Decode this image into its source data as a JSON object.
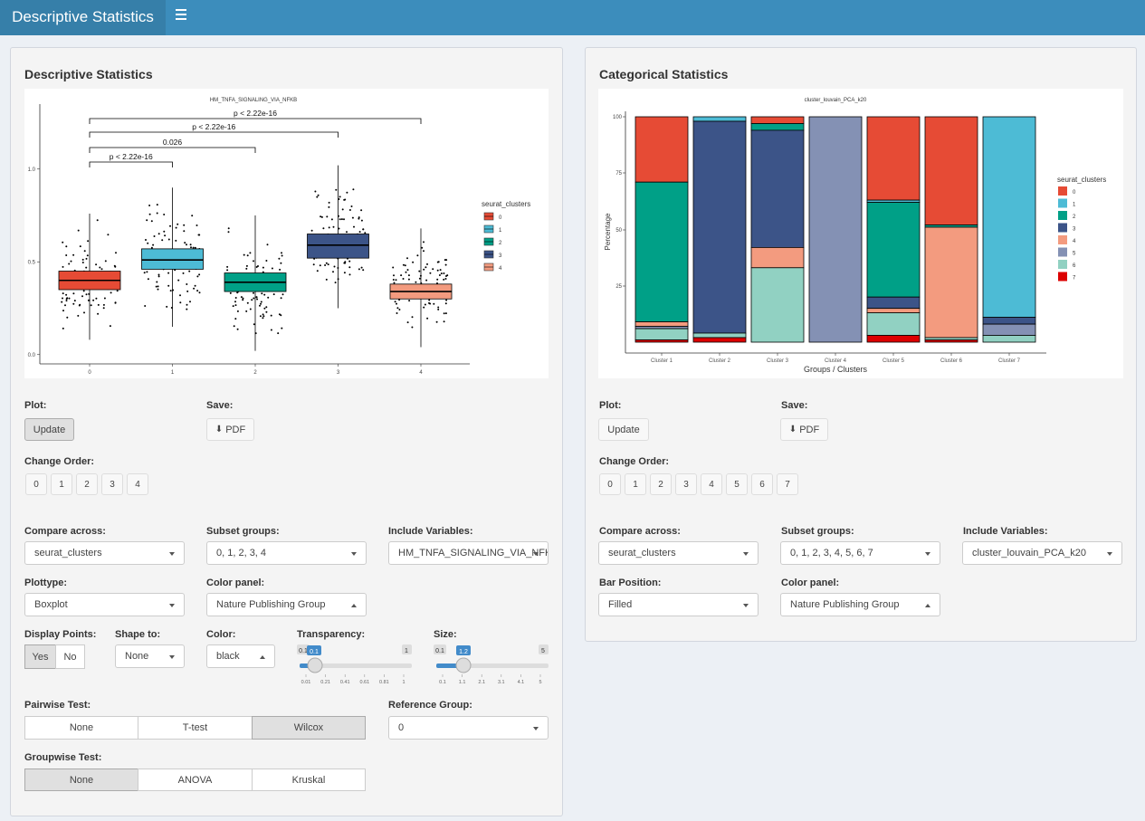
{
  "header": {
    "title": "Descriptive Statistics"
  },
  "left": {
    "title": "Descriptive Statistics",
    "plot": {
      "title": "HM_TNFA_SIGNALING_VIA_NFKB",
      "legend_title": "seurat_clusters",
      "legend": [
        "0",
        "1",
        "2",
        "3",
        "4"
      ],
      "yticks": [
        "0.0",
        "0.5",
        "1.0"
      ],
      "xticks": [
        "0",
        "1",
        "2",
        "3",
        "4"
      ],
      "pvals": [
        "p < 2.22e-16",
        "p < 2.22e-16",
        "0.026",
        "p < 2.22e-16"
      ]
    },
    "plot_label": "Plot:",
    "update": "Update",
    "save_label": "Save:",
    "pdf": "PDF",
    "order_label": "Change Order:",
    "order": [
      "0",
      "1",
      "2",
      "3",
      "4"
    ],
    "compare_label": "Compare across:",
    "compare": "seurat_clusters",
    "subset_label": "Subset groups:",
    "subset": "0, 1, 2, 3, 4",
    "include_label": "Include Variables:",
    "include": "HM_TNFA_SIGNALING_VIA_NFKB",
    "plottype_label": "Plottype:",
    "plottype": "Boxplot",
    "color_panel_label": "Color panel:",
    "color_panel": "Nature Publishing Group",
    "display_label": "Display Points:",
    "yes": "Yes",
    "no": "No",
    "shape_label": "Shape to:",
    "shape": "None",
    "color_label": "Color:",
    "color": "black",
    "transp_label": "Transparency:",
    "transp_val": "0.1",
    "transp_min": "0.1",
    "transp_max": "1",
    "transp_ticks": [
      "0.01",
      "0.21",
      "0.41",
      "0.61",
      "0.81",
      "1"
    ],
    "size_label": "Size:",
    "size_val": "1.2",
    "size_min": "0.1",
    "size_max": "5",
    "size_ticks": [
      "0.1",
      "1.1",
      "2.1",
      "3.1",
      "4.1",
      "5"
    ],
    "pairwise_label": "Pairwise Test:",
    "pairwise": [
      "None",
      "T-test",
      "Wilcox"
    ],
    "ref_label": "Reference Group:",
    "ref": "0",
    "groupwise_label": "Groupwise Test:",
    "groupwise": [
      "None",
      "ANOVA",
      "Kruskal"
    ]
  },
  "right": {
    "title": "Categorical Statistics",
    "plot": {
      "title": "cluster_louvain_PCA_k20",
      "ylabel": "Percentage",
      "xlabel": "Groups / Clusters",
      "legend_title": "seurat_clusters",
      "legend": [
        "0",
        "1",
        "2",
        "3",
        "4",
        "5",
        "6",
        "7"
      ],
      "yticks": [
        "25",
        "50",
        "75",
        "100"
      ],
      "xticks": [
        "Cluster 1",
        "Cluster 2",
        "Cluster 3",
        "Cluster 4",
        "Cluster 5",
        "Cluster 6",
        "Cluster 7"
      ]
    },
    "plot_label": "Plot:",
    "update": "Update",
    "save_label": "Save:",
    "pdf": "PDF",
    "order_label": "Change Order:",
    "order": [
      "0",
      "1",
      "2",
      "3",
      "4",
      "5",
      "6",
      "7"
    ],
    "compare_label": "Compare across:",
    "compare": "seurat_clusters",
    "subset_label": "Subset groups:",
    "subset": "0, 1, 2, 3, 4, 5, 6, 7",
    "include_label": "Include Variables:",
    "include": "cluster_louvain_PCA_k20",
    "barpos_label": "Bar Position:",
    "barpos": "Filled",
    "color_panel_label": "Color panel:",
    "color_panel": "Nature Publishing Group"
  },
  "colors": [
    "#E64B35",
    "#4DBBD5",
    "#00A087",
    "#3C5488",
    "#F39B7F",
    "#8491B4",
    "#91D1C2",
    "#DC0000"
  ],
  "chart_data": [
    {
      "type": "box",
      "title": "HM_TNFA_SIGNALING_VIA_NFKB",
      "categories": [
        "0",
        "1",
        "2",
        "3",
        "4"
      ],
      "ylim": [
        -0.05,
        1.35
      ],
      "boxes": [
        {
          "q1": 0.35,
          "median": 0.4,
          "q3": 0.45,
          "lo": 0.08,
          "hi": 0.76
        },
        {
          "q1": 0.46,
          "median": 0.51,
          "q3": 0.57,
          "lo": 0.15,
          "hi": 0.9
        },
        {
          "q1": 0.34,
          "median": 0.39,
          "q3": 0.44,
          "lo": 0.02,
          "hi": 0.75
        },
        {
          "q1": 0.52,
          "median": 0.59,
          "q3": 0.65,
          "lo": 0.25,
          "hi": 1.02
        },
        {
          "q1": 0.3,
          "median": 0.34,
          "q3": 0.38,
          "lo": 0.04,
          "hi": 0.68
        }
      ],
      "comparisons": [
        {
          "a": 0,
          "b": 1,
          "label": "p < 2.22e-16"
        },
        {
          "a": 0,
          "b": 2,
          "label": "0.026"
        },
        {
          "a": 0,
          "b": 3,
          "label": "p < 2.22e-16"
        },
        {
          "a": 0,
          "b": 4,
          "label": "p < 2.22e-16"
        }
      ]
    },
    {
      "type": "bar",
      "stacked": true,
      "title": "cluster_louvain_PCA_k20",
      "xlabel": "Groups / Clusters",
      "ylabel": "Percentage",
      "categories": [
        "Cluster 1",
        "Cluster 2",
        "Cluster 3",
        "Cluster 4",
        "Cluster 5",
        "Cluster 6",
        "Cluster 7"
      ],
      "ylim": [
        0,
        100
      ],
      "series": [
        {
          "name": "0",
          "values": [
            29,
            0,
            3,
            0,
            37,
            48,
            0
          ]
        },
        {
          "name": "1",
          "values": [
            0,
            2,
            0,
            0,
            1,
            0,
            89
          ]
        },
        {
          "name": "2",
          "values": [
            62,
            0,
            3,
            0,
            42,
            1,
            0
          ]
        },
        {
          "name": "3",
          "values": [
            0,
            94,
            52,
            0,
            5,
            0,
            3
          ]
        },
        {
          "name": "4",
          "values": [
            2,
            0,
            9,
            0,
            2,
            49,
            0
          ]
        },
        {
          "name": "5",
          "values": [
            1,
            0,
            0,
            100,
            0,
            0,
            5
          ]
        },
        {
          "name": "6",
          "values": [
            5,
            2,
            33,
            0,
            10,
            1,
            3
          ]
        },
        {
          "name": "7",
          "values": [
            1,
            2,
            0,
            0,
            3,
            1,
            0
          ]
        }
      ]
    }
  ]
}
